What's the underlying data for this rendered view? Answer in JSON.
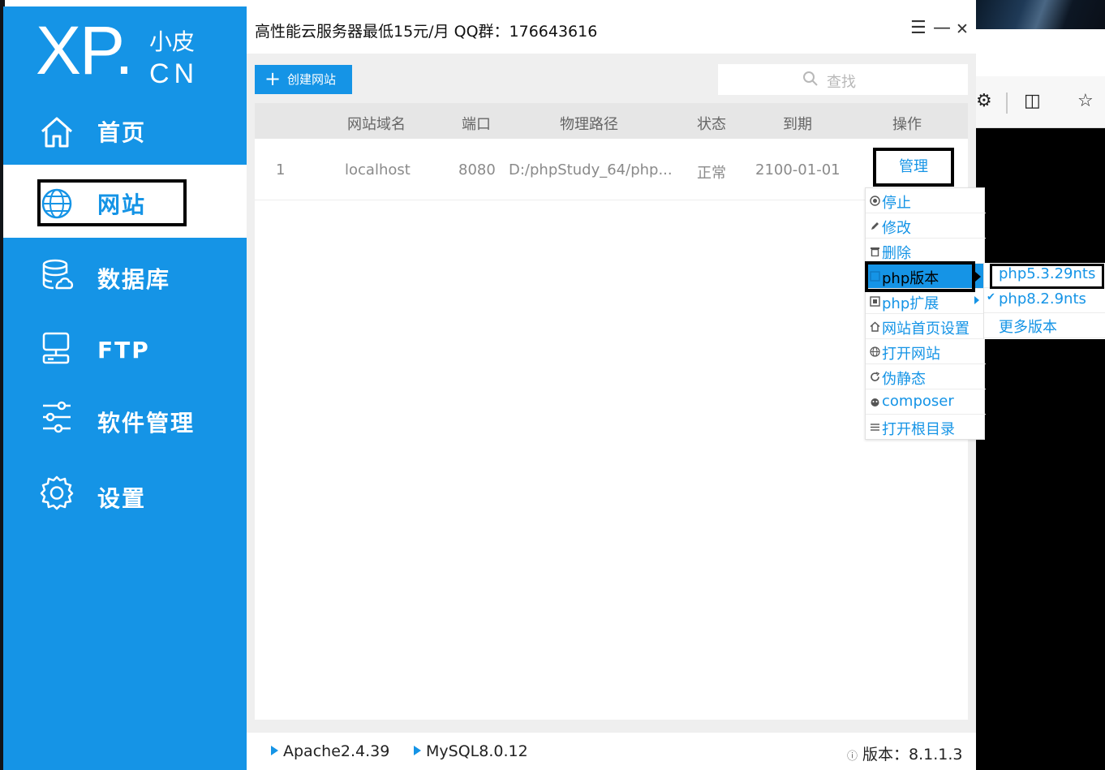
{
  "app": {
    "logo": {
      "main": "XP.",
      "sub_top": "小皮",
      "sub_bottom": "CN"
    },
    "title": "高性能云服务器最低15元/月  QQ群：176643616",
    "window_controls": {
      "menu": "☰",
      "minimize": "—",
      "close": "✕"
    }
  },
  "sidebar": {
    "items": [
      {
        "label": "首页",
        "icon": "home-icon",
        "active": false
      },
      {
        "label": "网站",
        "icon": "globe-icon",
        "active": true
      },
      {
        "label": "数据库",
        "icon": "database-icon",
        "active": false
      },
      {
        "label": "FTP",
        "icon": "ftp-icon",
        "active": false
      },
      {
        "label": "软件管理",
        "icon": "sliders-icon",
        "active": false
      },
      {
        "label": "设置",
        "icon": "gear-icon",
        "active": false
      }
    ]
  },
  "toolbar": {
    "create_label": "创建网站",
    "search_placeholder": "查找"
  },
  "table": {
    "headers": [
      "网站域名",
      "端口",
      "物理路径",
      "状态",
      "到期",
      "操作"
    ],
    "rows": [
      {
        "index": "1",
        "domain": "localhost",
        "port": "8080",
        "path": "D:/phpStudy_64/php...",
        "status": "正常",
        "expire": "2100-01-01",
        "action": "管理"
      }
    ]
  },
  "context_menu": {
    "items": [
      {
        "label": "停止",
        "icon": "stop-icon"
      },
      {
        "label": "修改",
        "icon": "edit-icon"
      },
      {
        "label": "删除",
        "icon": "trash-icon"
      },
      {
        "label": "php版本",
        "icon": "php-icon",
        "has_submenu": true,
        "highlighted": true
      },
      {
        "label": "php扩展",
        "icon": "extension-icon",
        "has_submenu": true
      },
      {
        "label": "网站首页设置",
        "icon": "home-icon"
      },
      {
        "label": "打开网站",
        "icon": "globe-icon"
      },
      {
        "label": "伪静态",
        "icon": "refresh-icon"
      },
      {
        "label": "composer",
        "icon": "composer-icon"
      },
      {
        "label": "打开根目录",
        "icon": "list-icon"
      }
    ]
  },
  "php_version_submenu": {
    "items": [
      {
        "label": "php5.3.29nts",
        "checked": false,
        "boxed": true
      },
      {
        "label": "php8.2.9nts",
        "checked": true
      },
      {
        "label": "更多版本",
        "checked": false
      }
    ],
    "check_mark": "✔"
  },
  "footer": {
    "apache": "Apache2.4.39",
    "mysql": "MySQL8.0.12",
    "version": "版本：8.1.1.3"
  },
  "colors": {
    "accent": "#1594e6",
    "sidebar": "#1594e6",
    "header_bg": "#e6e6e6"
  }
}
